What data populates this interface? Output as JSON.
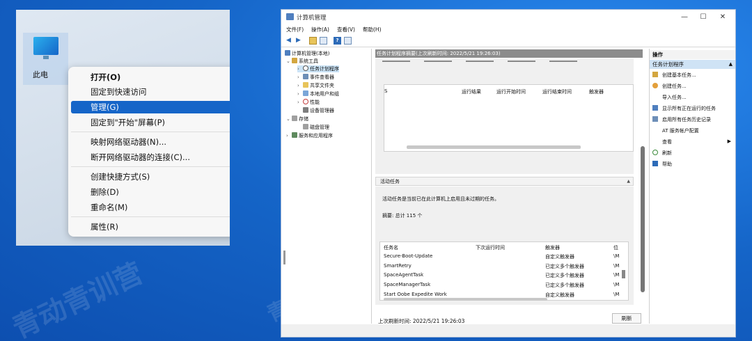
{
  "context_menu": {
    "items": [
      {
        "label": "打开(O)"
      },
      {
        "label": "固定到快速访问"
      },
      {
        "label": "管理(G)"
      },
      {
        "label": "固定到\"开始\"屏幕(P)"
      },
      {
        "label": "映射网络驱动器(N)..."
      },
      {
        "label": "断开网络驱动器的连接(C)..."
      },
      {
        "label": "创建快捷方式(S)"
      },
      {
        "label": "删除(D)"
      },
      {
        "label": "重命名(M)"
      },
      {
        "label": "属性(R)"
      }
    ]
  },
  "desktop_icon": {
    "label": "此电"
  },
  "window": {
    "title": "计算机管理",
    "controls": {
      "minimize": "—",
      "maximize": "☐",
      "close": "✕"
    },
    "menubar": [
      "文件(F)",
      "操作(A)",
      "查看(V)",
      "帮助(H)"
    ],
    "tree": {
      "root": "计算机管理(本地)",
      "items": [
        {
          "label": "系统工具"
        },
        {
          "label": "任务计划程序"
        },
        {
          "label": "事件查看器"
        },
        {
          "label": "共享文件夹"
        },
        {
          "label": "本地用户和组"
        },
        {
          "label": "性能"
        },
        {
          "label": "设备管理器"
        },
        {
          "label": "存储"
        },
        {
          "label": "磁盘管理"
        },
        {
          "label": "服务和应用程序"
        }
      ]
    },
    "center": {
      "header": "任务计划程序摘要(上次刷新时间: 2022/5/21 19:26:03)",
      "status_table_columns": [
        "S",
        "运行结果",
        "运行开始时间",
        "运行结束时间",
        "触发器"
      ],
      "active_tasks_title": "活动任务",
      "active_tasks_desc": "活动任务是当前已在此计算机上启用且未过期的任务。",
      "summary": "摘要: 总计 115 个",
      "table": {
        "columns": [
          "任务名",
          "下次运行时间",
          "触发器",
          "位"
        ],
        "rows": [
          {
            "name": "Secure-Boot-Update",
            "next": "",
            "trigger": "自定义触发器",
            "loc": "\\M"
          },
          {
            "name": "SmartRetry",
            "next": "",
            "trigger": "已定义多个触发器",
            "loc": "\\M"
          },
          {
            "name": "SpaceAgentTask",
            "next": "",
            "trigger": "已定义多个触发器",
            "loc": "\\M"
          },
          {
            "name": "SpaceManagerTask",
            "next": "",
            "trigger": "已定义多个触发器",
            "loc": "\\M"
          },
          {
            "name": "Start Oobe Expedite Work",
            "next": "",
            "trigger": "自定义触发器",
            "loc": "\\M"
          }
        ]
      },
      "last_refresh": "上次刷新时间: 2022/5/21 19:26:03",
      "refresh_button": "刷新"
    },
    "actions": {
      "header": "操作",
      "subheader": "任务计划程序",
      "items": [
        {
          "label": "创建基本任务..."
        },
        {
          "label": "创建任务..."
        },
        {
          "label": "导入任务..."
        },
        {
          "label": "显示所有正在运行的任务"
        },
        {
          "label": "启用所有任务历史记录"
        },
        {
          "label": "AT 服务帐户配置"
        },
        {
          "label": "查看"
        },
        {
          "label": "刷新"
        },
        {
          "label": "帮助"
        }
      ]
    }
  },
  "colors": {
    "accent": "#1565c8",
    "selection": "#cce4f7"
  }
}
